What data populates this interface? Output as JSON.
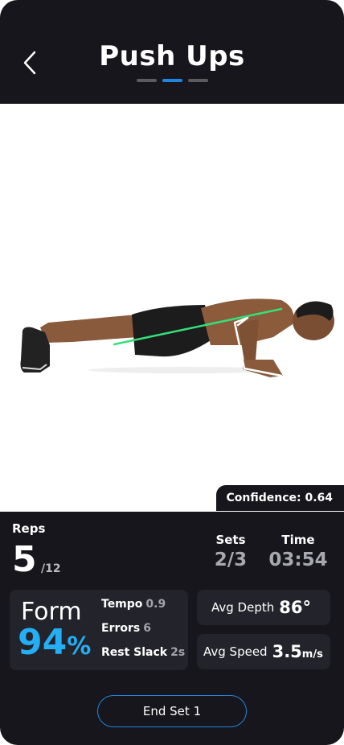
{
  "header": {
    "title": "Push Ups",
    "pages": 3,
    "active_page": 1
  },
  "video": {
    "confidence": "Confidence: 0.64"
  },
  "stats": {
    "reps_label": "Reps",
    "reps_value": "5",
    "reps_total": "/12",
    "sets_label": "Sets",
    "sets_value": "2/3",
    "time_label": "Time",
    "time_value": "03:54"
  },
  "form": {
    "label": "Form",
    "value": "94",
    "unit": "%",
    "tempo_label": "Tempo",
    "tempo_value": "0.9",
    "errors_label": "Errors",
    "errors_value": "6",
    "rest_label": "Rest Slack",
    "rest_value": "2s"
  },
  "depth": {
    "label": "Avg Depth",
    "value": "86°"
  },
  "speed": {
    "label": "Avg Speed",
    "value": "3.5",
    "unit": "m/s"
  },
  "actions": {
    "end_set": "End Set 1"
  },
  "colors": {
    "accent_blue": "#1f86e0",
    "form_blue": "#24aef5",
    "pose_line": "#33e07a",
    "background": "#16161c"
  }
}
